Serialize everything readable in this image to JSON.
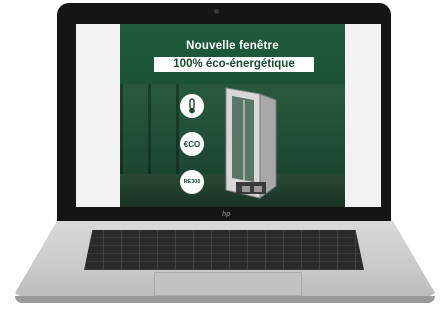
{
  "ad": {
    "headline_line1": "Nouvelle fenêtre",
    "headline_line2": "100% éco-énergétique",
    "badge_eco": "€CO",
    "badge_recycle": "RE300"
  },
  "laptop": {
    "logo": "hp"
  },
  "colors": {
    "ad_green": "#1a5236",
    "laptop_body": "#c9c9c9"
  }
}
